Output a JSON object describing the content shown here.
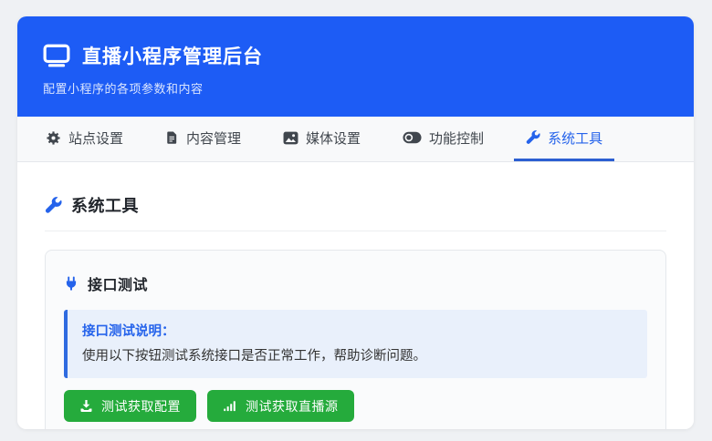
{
  "header": {
    "title": "直播小程序管理后台",
    "subtitle": "配置小程序的各项参数和内容",
    "icon": "monitor-icon",
    "bg_color": "#1d5cf5"
  },
  "tabs": [
    {
      "label": "站点设置",
      "icon": "gear-icon",
      "active": false
    },
    {
      "label": "内容管理",
      "icon": "document-icon",
      "active": false
    },
    {
      "label": "媒体设置",
      "icon": "image-icon",
      "active": false
    },
    {
      "label": "功能控制",
      "icon": "toggle-icon",
      "active": false
    },
    {
      "label": "系统工具",
      "icon": "wrench-icon",
      "active": true
    }
  ],
  "section": {
    "title": "系统工具",
    "icon": "wrench-icon"
  },
  "api_test_card": {
    "title": "接口测试",
    "icon": "plug-icon",
    "note_title": "接口测试说明：",
    "note_body": "使用以下按钮测试系统接口是否正常工作，帮助诊断问题。",
    "buttons": [
      {
        "label": "测试获取配置",
        "icon": "download-icon"
      },
      {
        "label": "测试获取直播源",
        "icon": "signal-bars-icon"
      }
    ]
  },
  "colors": {
    "header_blue": "#1d5cf5",
    "accent_blue": "#2563eb",
    "active_underline": "#2c5fd2",
    "success_green": "#25ab3c",
    "info_bg": "#e9f0fb",
    "page_bg": "#eff1f4",
    "tabbar_bg": "#f8f9fa"
  }
}
